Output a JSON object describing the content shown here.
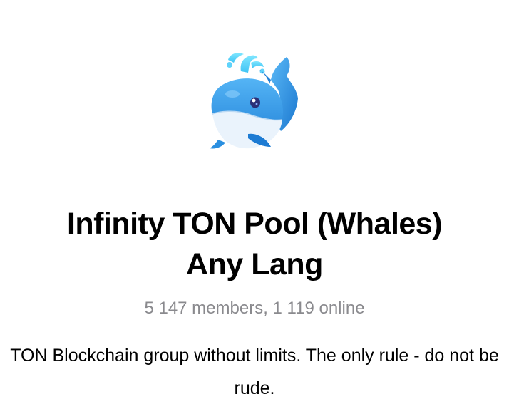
{
  "channel": {
    "avatar_icon": "whale-icon",
    "title_line_1": "Infinity TON Pool (Whales)",
    "title_line_2": "Any Lang",
    "members_text": "5 147 members, 1 119 online",
    "description": "TON Blockchain group without limits. The only rule - do not be rude."
  },
  "colors": {
    "title": "#000000",
    "meta": "#8a8a8e",
    "whale_blue": "#2a8fe0",
    "whale_belly": "#e8f2fb"
  }
}
